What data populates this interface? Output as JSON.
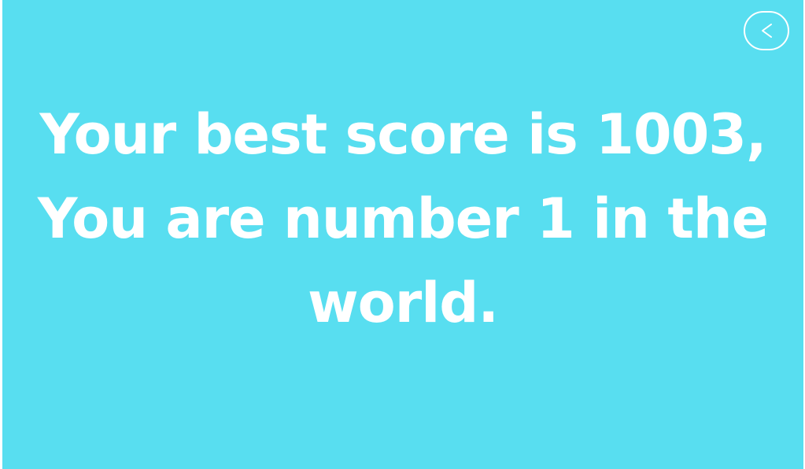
{
  "back_button": {
    "icon": "chevron-left-icon",
    "label": "<"
  },
  "message": {
    "lines": [
      "Your best score is 1003,",
      "You are number 1 in the",
      "world."
    ]
  },
  "colors": {
    "background": "#58def0",
    "foreground": "#ffffff"
  }
}
